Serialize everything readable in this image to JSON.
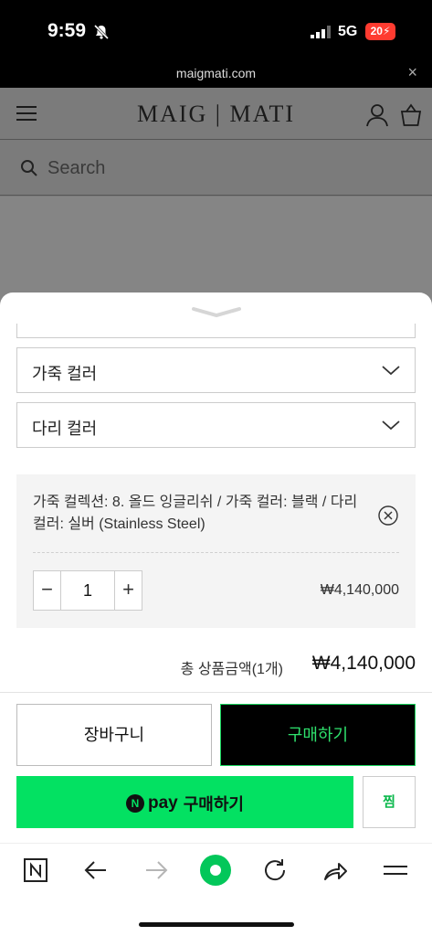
{
  "status_bar": {
    "time": "9:59",
    "network": "5G",
    "battery": "20"
  },
  "browser": {
    "url": "maigmati.com",
    "close_label": "×"
  },
  "site": {
    "logo": "MAIG | MATI",
    "search_placeholder": "Search"
  },
  "sheet": {
    "selects": [
      {
        "label": "가죽 컬러"
      },
      {
        "label": "다리 컬러"
      }
    ],
    "selected_option": {
      "text": "가죽 컬렉션: 8. 올드 잉글리쉬 / 가죽 컬러: 블랙 / 다리 컬러: 실버 (Stainless Steel)",
      "quantity": "1",
      "minus": "−",
      "plus": "+",
      "price": "₩4,140,000"
    },
    "total": {
      "label": "총 상품금액(1개)",
      "value": "₩4,140,000"
    },
    "buttons": {
      "cart": "장바구니",
      "buy": "구매하기",
      "npay_logo": "N",
      "npay_word": "pay",
      "npay_label": "구매하기",
      "wish": "찜"
    }
  },
  "colors": {
    "npay_green": "#03e162",
    "buy_text_green": "#2fe16d",
    "battery_red": "#ff3b30",
    "toolbar_active": "#03c75a"
  },
  "toolbar": {
    "icons": [
      "naver-n-icon",
      "back-arrow-icon",
      "forward-arrow-icon",
      "green-dot-icon",
      "refresh-icon",
      "share-icon",
      "menu-icon"
    ]
  }
}
